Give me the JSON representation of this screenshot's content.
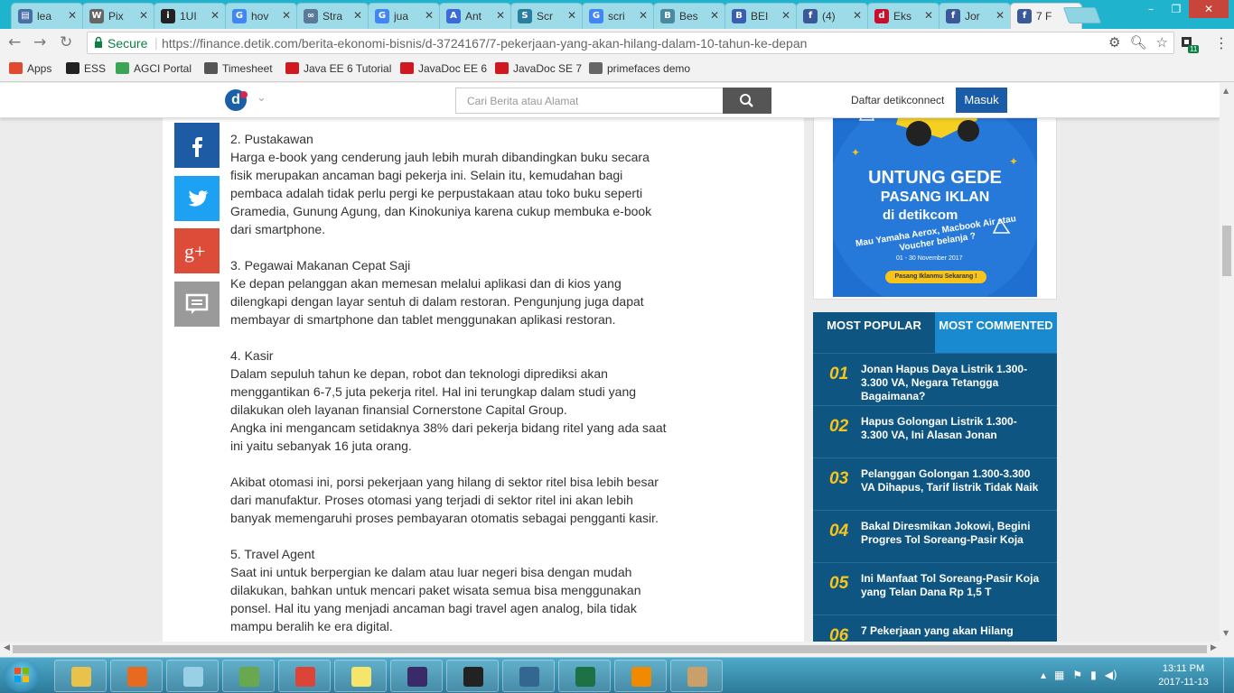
{
  "browser": {
    "tabs": [
      {
        "label": "lea",
        "favicon": "doc-icon",
        "color": "#4a6fa5",
        "glyph": "▤"
      },
      {
        "label": "Pix",
        "favicon": "wikipedia-icon",
        "color": "#666666",
        "glyph": "W"
      },
      {
        "label": "1UI",
        "favicon": "info-icon",
        "color": "#222222",
        "glyph": "i"
      },
      {
        "label": "hov",
        "favicon": "google-icon",
        "color": "#4285f4",
        "glyph": "G"
      },
      {
        "label": "Stra",
        "favicon": "ebay-icon",
        "color": "#5a7a9a",
        "glyph": "∞"
      },
      {
        "label": "jua",
        "favicon": "google-icon",
        "color": "#4285f4",
        "glyph": "G"
      },
      {
        "label": "Ant",
        "favicon": "a-icon",
        "color": "#3b6bd6",
        "glyph": "A"
      },
      {
        "label": "Scr",
        "favicon": "tool-icon",
        "color": "#2a7fa0",
        "glyph": "S"
      },
      {
        "label": "scri",
        "favicon": "google-icon",
        "color": "#4285f4",
        "glyph": "G"
      },
      {
        "label": "Bes",
        "favicon": "bus-icon",
        "color": "#4a8aa0",
        "glyph": "B"
      },
      {
        "label": "BEI",
        "favicon": "b-icon",
        "color": "#3a5fb0",
        "glyph": "B"
      },
      {
        "label": "(4)",
        "favicon": "facebook-icon",
        "color": "#3b5998",
        "glyph": "f"
      },
      {
        "label": "Eks",
        "favicon": "detik-icon",
        "color": "#c8102e",
        "glyph": "d"
      },
      {
        "label": "Jor",
        "favicon": "facebook-icon",
        "color": "#3b5998",
        "glyph": "f"
      },
      {
        "label": "7 F",
        "favicon": "facebook-icon",
        "color": "#3b5998",
        "glyph": "f",
        "active": true
      }
    ],
    "address": {
      "secure_label": "Secure",
      "url": "https://finance.detik.com/berita-ekonomi-bisnis/d-3724167/7-pekerjaan-yang-akan-hilang-dalam-10-tahun-ke-depan"
    },
    "extension_badge": "11",
    "bookmarks": [
      {
        "label": "Apps",
        "icon": "apps-grid-icon",
        "color": "#e04b2f"
      },
      {
        "label": "ESS",
        "icon": "ess-icon",
        "color": "#222222"
      },
      {
        "label": "AGCI Portal",
        "icon": "agci-icon",
        "color": "#3aa655"
      },
      {
        "label": "Timesheet",
        "icon": "timesheet-icon",
        "color": "#555555"
      },
      {
        "label": "Java EE 6 Tutorial",
        "icon": "oracle-icon",
        "color": "#d0191f"
      },
      {
        "label": "JavaDoc EE 6",
        "icon": "oracle-icon",
        "color": "#d0191f"
      },
      {
        "label": "JavaDoc SE 7",
        "icon": "oracle-icon",
        "color": "#d0191f"
      },
      {
        "label": "primefaces demo",
        "icon": "primefaces-icon",
        "color": "#666666"
      }
    ]
  },
  "site": {
    "search_placeholder": "Cari Berita atau Alamat",
    "register_label": "Daftar detikconnect",
    "login_label": "Masuk",
    "logo_letter": "d"
  },
  "article": {
    "paragraphs": [
      "2. Pustakawan",
      "Harga e-book yang cenderung jauh lebih murah dibandingkan buku secara fisik merupakan ancaman bagi pekerja ini. Selain itu, kemudahan bagi pembaca adalah tidak perlu pergi ke perpustakaan atau toko buku seperti Gramedia, Gunung Agung, dan Kinokuniya karena cukup membuka e-book dari smartphone.",
      "",
      "3. Pegawai Makanan Cepat Saji",
      "Ke depan pelanggan akan memesan melalui aplikasi dan di kios yang dilengkapi dengan layar sentuh di dalam restoran. Pengunjung juga dapat membayar di smartphone dan tablet menggunakan aplikasi restoran.",
      "",
      "4. Kasir",
      "Dalam sepuluh tahun ke depan, robot dan teknologi diprediksi akan menggantikan 6-7,5 juta pekerja ritel. Hal ini terungkap dalam studi yang dilakukan oleh layanan finansial Cornerstone Capital Group.",
      "Angka ini mengancam setidaknya 38% dari pekerja bidang ritel yang ada saat ini yaitu sebanyak 16 juta orang.",
      "",
      "Akibat otomasi ini, porsi pekerjaan yang hilang di sektor ritel bisa lebih besar dari manufaktur. Proses otomasi yang terjadi di sektor ritel ini akan lebih banyak memengaruhi proses pembayaran otomatis sebagai pengganti kasir.",
      "",
      "5. Travel Agent",
      "Saat ini untuk berpergian ke dalam atau luar negeri bisa dengan mudah dilakukan, bahkan untuk mencari paket wisata semua bisa menggunakan ponsel. Hal itu yang menjadi ancaman bagi travel agen analog, bila tidak mampu beralih ke era digital."
    ]
  },
  "ad": {
    "headline1": "UNTUNG GEDE",
    "headline2": "PASANG IKLAN",
    "brand": "di detikcom",
    "sub": "Mau Yamaha Aerox, Macbook Air atau Voucher belanja ?",
    "date": "01 - 30 November 2017",
    "cta": "Pasang Iklanmu Sekarang !"
  },
  "popular": {
    "tab_popular": "MOST POPULAR",
    "tab_commented": "MOST COMMENTED",
    "items": [
      {
        "num": "01",
        "title": "Jonan Hapus Daya Listrik 1.300-3.300 VA, Negara Tetangga Bagaimana?"
      },
      {
        "num": "02",
        "title": "Hapus Golongan Listrik 1.300-3.300 VA, Ini Alasan Jonan"
      },
      {
        "num": "03",
        "title": "Pelanggan Golongan 1.300-3.300 VA Dihapus, Tarif listrik Tidak Naik"
      },
      {
        "num": "04",
        "title": "Bakal Diresmikan Jokowi, Begini Progres Tol Soreang-Pasir Koja"
      },
      {
        "num": "05",
        "title": "Ini Manfaat Tol Soreang-Pasir Koja yang Telan Dana Rp 1,5 T"
      },
      {
        "num": "06",
        "title": "7 Pekerjaan yang akan Hilang"
      }
    ]
  },
  "taskbar": {
    "apps": [
      {
        "name": "explorer-icon",
        "color": "#e8c24a"
      },
      {
        "name": "firefox-icon",
        "color": "#e86a1f"
      },
      {
        "name": "notepad-icon",
        "color": "#9ad0e6"
      },
      {
        "name": "chart-tool-icon",
        "color": "#6aa84f"
      },
      {
        "name": "chrome-icon",
        "color": "#db4437"
      },
      {
        "name": "sticky-notes-icon",
        "color": "#f5e56b"
      },
      {
        "name": "java-ee-ide-icon",
        "color": "#3a2a6a"
      },
      {
        "name": "inkscape-icon",
        "color": "#222222"
      },
      {
        "name": "postgres-icon",
        "color": "#336791"
      },
      {
        "name": "excel-icon",
        "color": "#1e7145"
      },
      {
        "name": "vlc-icon",
        "color": "#f08a00"
      },
      {
        "name": "paint-icon",
        "color": "#c9a06a"
      }
    ],
    "time": "13:11 PM",
    "date": "2017-11-13"
  }
}
